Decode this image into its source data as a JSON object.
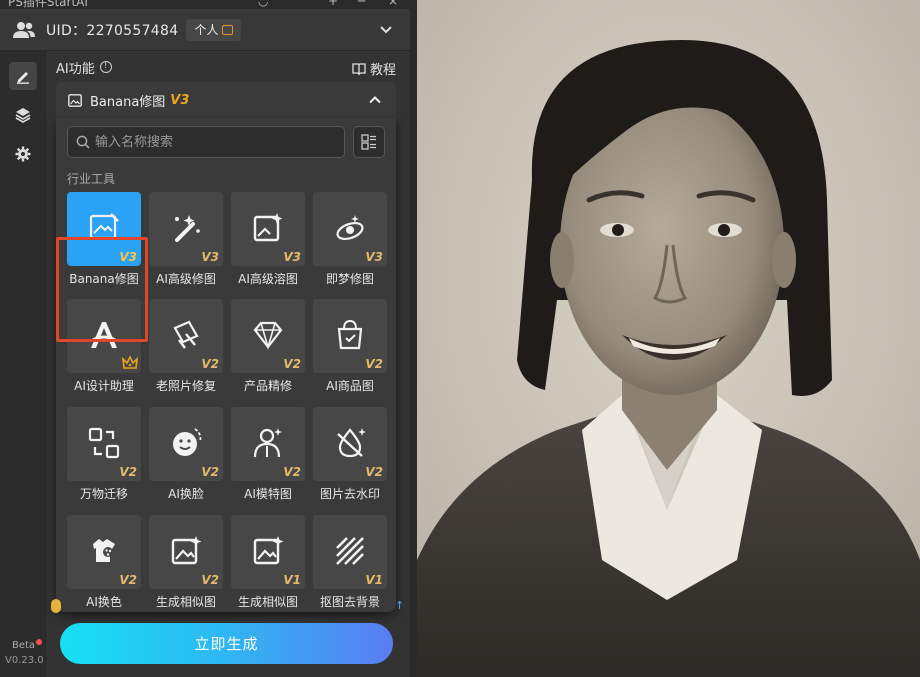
{
  "app": {
    "title": "PS插件StartAI"
  },
  "account": {
    "uid_text": "UID：2270557484",
    "badge_label": "个人"
  },
  "section": {
    "title": "AI功能",
    "tutorial_label": "教程"
  },
  "dropdown": {
    "name": "Banana修图",
    "version": "V3"
  },
  "search": {
    "placeholder": "输入名称搜索",
    "value": ""
  },
  "category_label": "行业工具",
  "tools": [
    {
      "label": "Banana修图",
      "badge": "V3",
      "icon": "image-edit-icon",
      "selected": true
    },
    {
      "label": "AI高级修图",
      "badge": "V3",
      "icon": "magic-wand-icon"
    },
    {
      "label": "AI高级溶图",
      "badge": "V3",
      "icon": "image-sparkle-icon"
    },
    {
      "label": "即梦修图",
      "badge": "V3",
      "icon": "dream-brush-icon"
    },
    {
      "label": "AI设计助理",
      "badge": "crown",
      "icon": "ai-design-icon"
    },
    {
      "label": "老照片修复",
      "badge": "V2",
      "icon": "photo-restore-icon"
    },
    {
      "label": "产品精修",
      "badge": "V2",
      "icon": "diamond-icon"
    },
    {
      "label": "AI商品图",
      "badge": "V2",
      "icon": "shopping-bag-icon"
    },
    {
      "label": "万物迁移",
      "badge": "V2",
      "icon": "transfer-icon"
    },
    {
      "label": "AI换脸",
      "badge": "V2",
      "icon": "face-swap-icon"
    },
    {
      "label": "AI模特图",
      "badge": "V2",
      "icon": "model-person-icon"
    },
    {
      "label": "图片去水印",
      "badge": "V2",
      "icon": "watermark-remove-icon"
    },
    {
      "label": "AI换色",
      "badge": "V2",
      "icon": "color-palette-icon"
    },
    {
      "label": "生成相似图",
      "badge": "V2",
      "icon": "similar-image-icon"
    },
    {
      "label": "生成相似图",
      "badge": "V1",
      "icon": "similar-image-icon"
    },
    {
      "label": "抠图去背景",
      "badge": "V1",
      "icon": "cutout-stripes-icon"
    }
  ],
  "generate_button": "立即生成",
  "sidebar": {
    "beta": "Beta",
    "version": "V0.23.0"
  },
  "colors": {
    "accent": "#2aa2f5",
    "badge_gold": "#e8a61c",
    "highlight_frame": "#e0462b"
  }
}
